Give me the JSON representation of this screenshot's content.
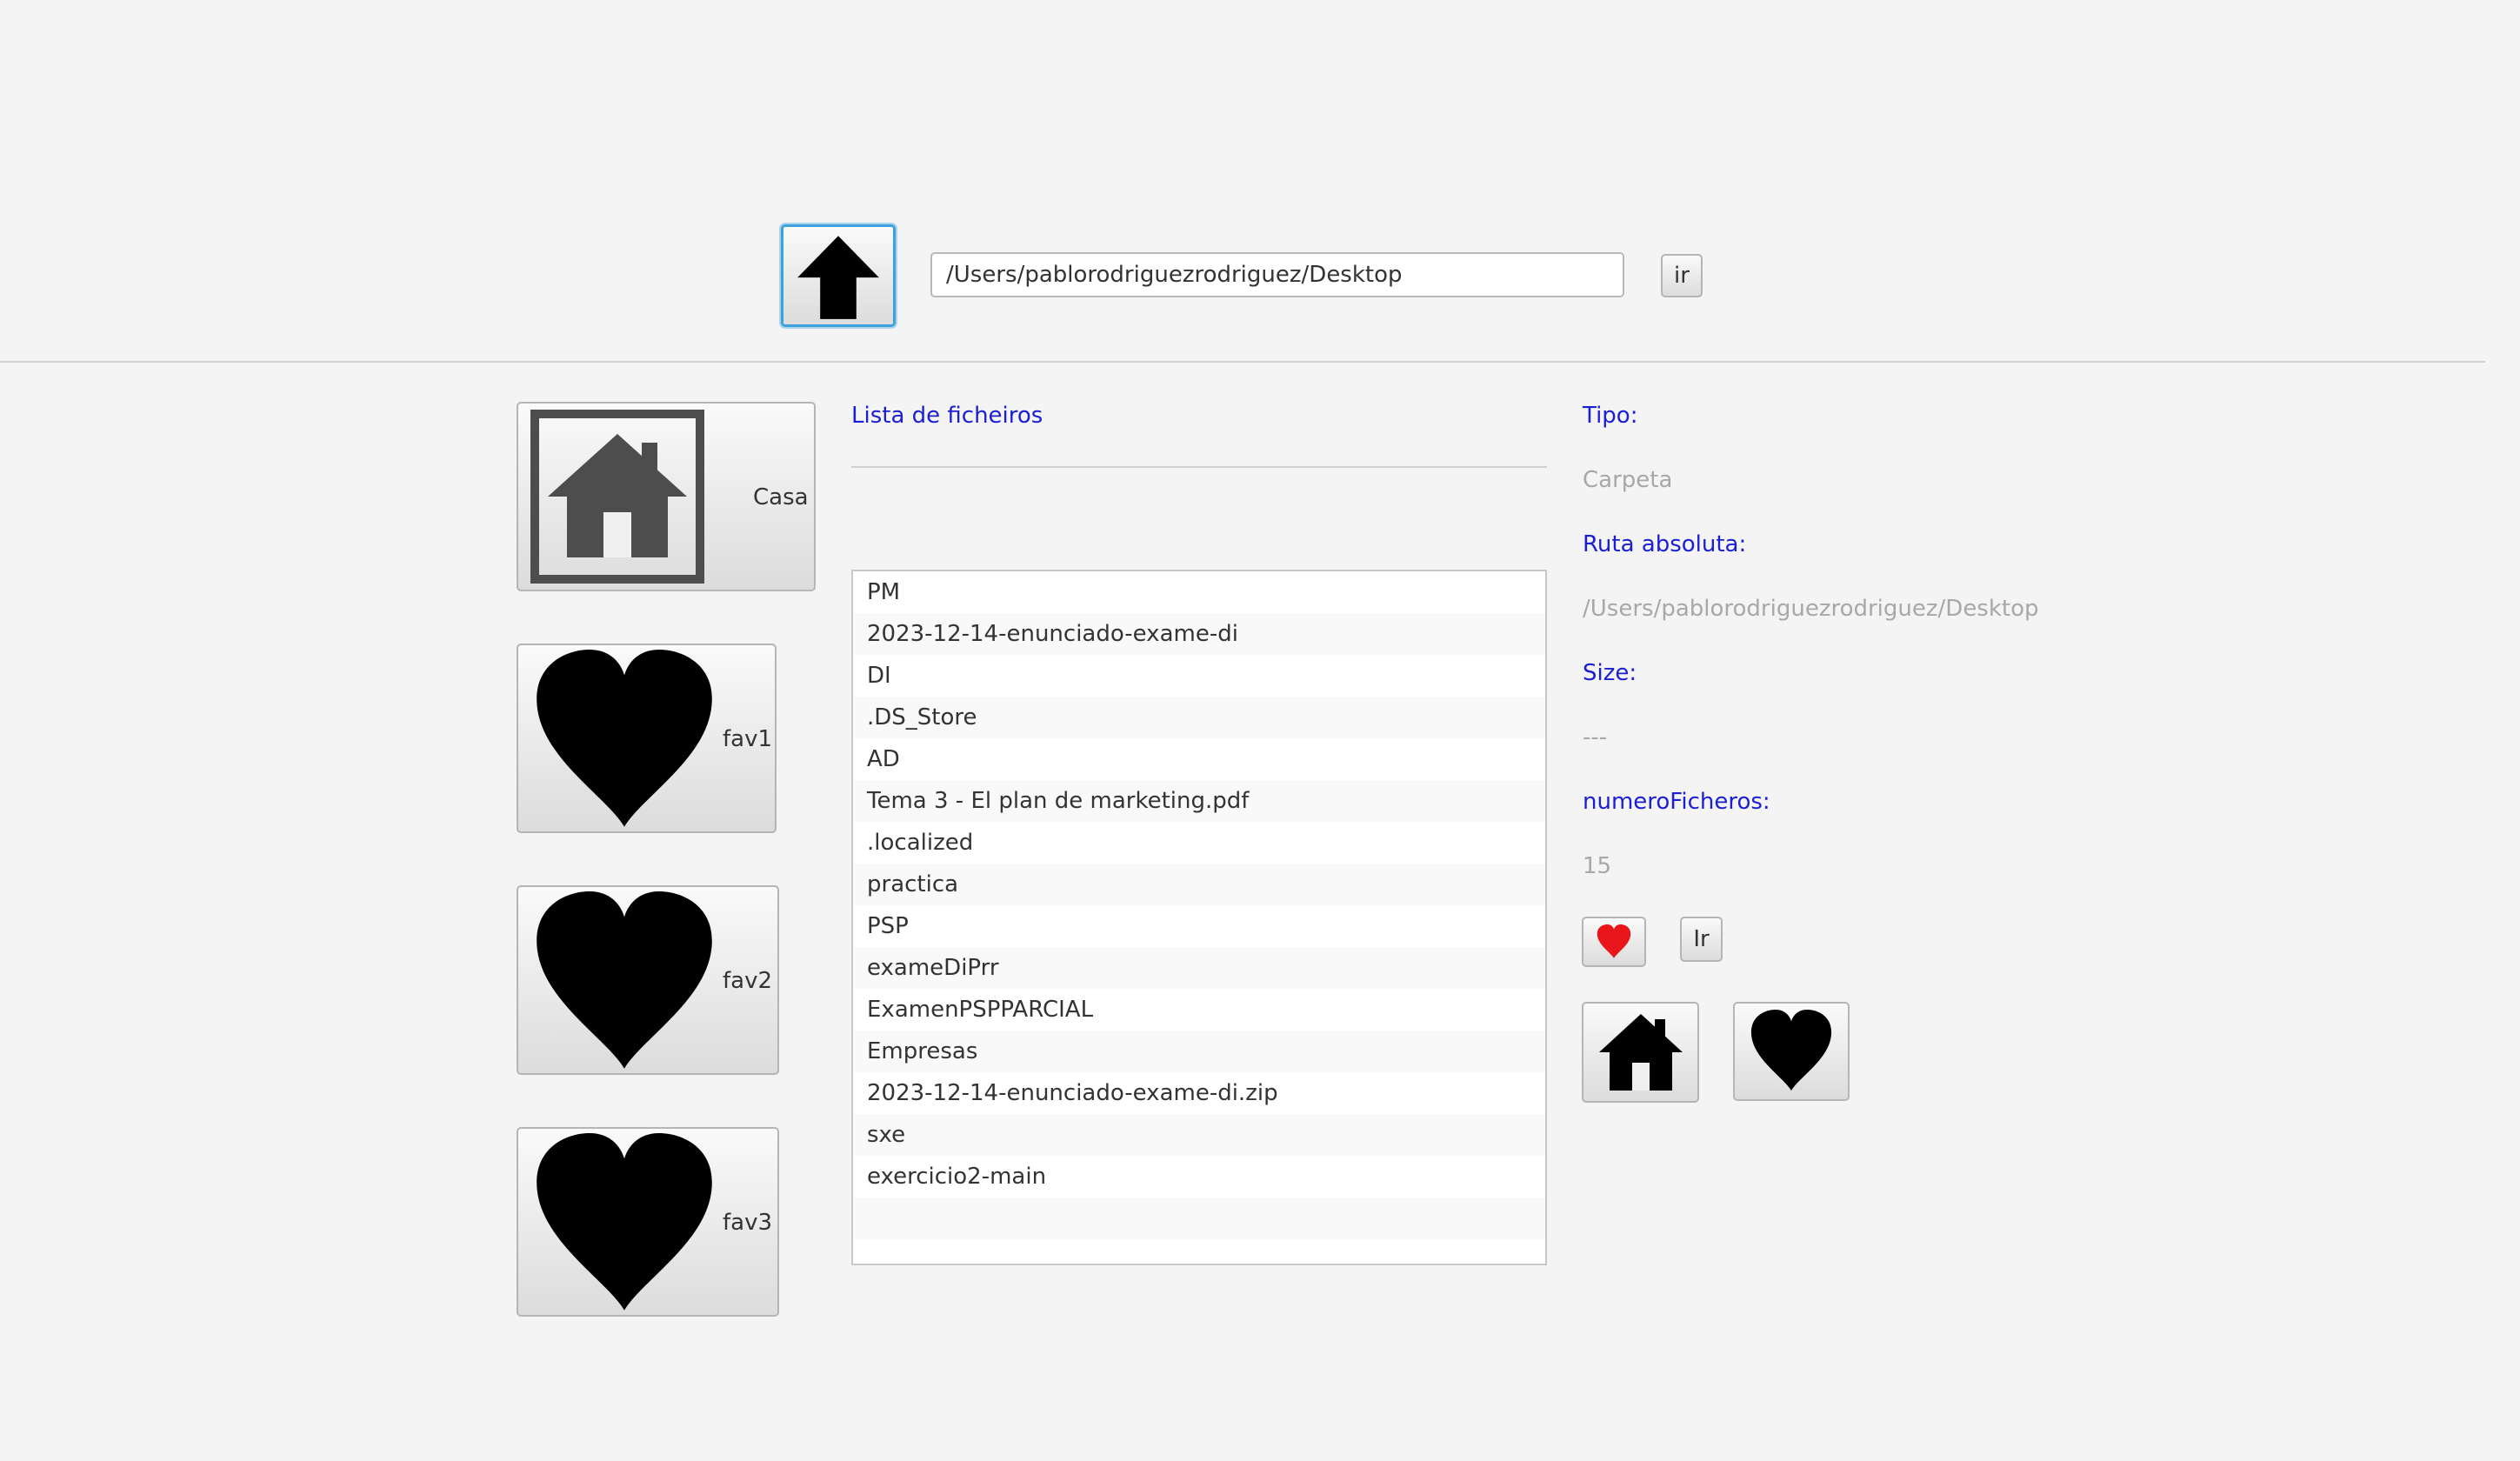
{
  "toolbar": {
    "up_icon": "arrow-up-icon",
    "path_value": "/Users/pablorodriguezrodriguez/Desktop",
    "go_label": "ir"
  },
  "sidebar": {
    "home_label": "Casa",
    "home_icon": "house-icon",
    "favorites": [
      {
        "label": "fav1",
        "icon": "heart-icon"
      },
      {
        "label": "fav2",
        "icon": "heart-icon"
      },
      {
        "label": "fav3",
        "icon": "heart-icon"
      }
    ]
  },
  "file_list": {
    "heading": "Lista de ficheiros",
    "items": [
      "PM",
      "2023-12-14-enunciado-exame-di",
      "DI",
      ".DS_Store",
      "AD",
      "Tema 3 - El plan de marketing.pdf",
      ".localized",
      "practica",
      "PSP",
      "exameDiPrr",
      "ExamenPSPPARCIAL",
      "Empresas",
      "2023-12-14-enunciado-exame-di.zip",
      "sxe",
      "exercicio2-main"
    ]
  },
  "details": {
    "type_label": "Tipo:",
    "type_value": "Carpeta",
    "path_label": "Ruta absoluta:",
    "path_value": "/Users/pablorodriguezrodriguez/Desktop",
    "size_label": "Size:",
    "size_value": "---",
    "count_label": "numeroFicheros:",
    "count_value": "15",
    "go_label": "Ir"
  },
  "colors": {
    "accent_label": "#1a1fd6",
    "focus_border": "#3ea0dc",
    "favorite_heart": "#e8151b",
    "dark_icon": "#4d4d4d"
  }
}
